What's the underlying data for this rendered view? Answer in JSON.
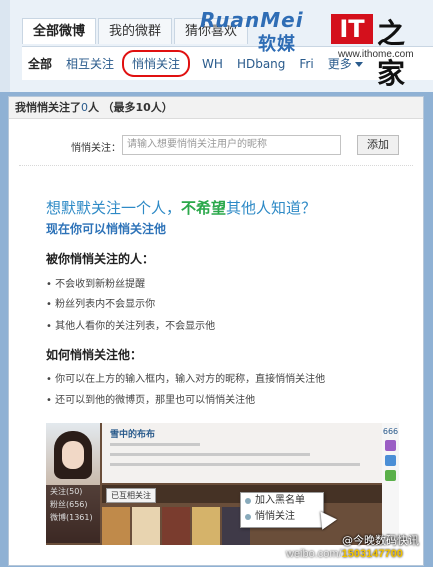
{
  "tabs_primary": [
    {
      "label": "全部微博",
      "active": true
    },
    {
      "label": "我的微群",
      "active": false
    },
    {
      "label": "猜你喜欢",
      "active": false
    }
  ],
  "tabs_secondary": [
    {
      "label": "全部",
      "active": true
    },
    {
      "label": "相互关注",
      "active": false
    },
    {
      "label": "悄悄关注",
      "active": false,
      "highlighted": true
    },
    {
      "label": "WH",
      "active": false
    },
    {
      "label": "HDbang",
      "active": false
    },
    {
      "label": "Fri",
      "active": false
    },
    {
      "label": "更多",
      "active": false
    }
  ],
  "logos": {
    "ruanmei_en": "RuanMei",
    "ruanmei_cn": "软媒",
    "ithome_it": "IT",
    "ithome_zh": "之家",
    "ithome_url": "www.ithome.com"
  },
  "panel": {
    "title_prefix": "我悄悄关注了",
    "count": "0",
    "title_suffix": "人",
    "limit": "（最多10人）",
    "add_label": "悄悄关注：",
    "add_placeholder": "请输入想要悄悄关注用户的昵称",
    "add_button": "添加"
  },
  "intro": {
    "headline_a": "想默默关注一个人，",
    "headline_b": "不希望",
    "headline_c": "其他人知道？",
    "subhead": "现在你可以悄悄关注他"
  },
  "sections": [
    {
      "title": "被你悄悄关注的人：",
      "items": [
        "• 不会收到新粉丝提醒",
        "• 粉丝列表内不会显示你",
        "• 其他人看你的关注列表，不会显示他"
      ]
    },
    {
      "title": "如何悄悄关注他：",
      "items": [
        "• 你可以在上方的输入框内，输入对方的昵称，直接悄悄关注他",
        "• 还可以到他的微博页，那里也可以悄悄关注他"
      ]
    }
  ],
  "illustration": {
    "name": "雪中的布布",
    "side_items": [
      "关注(50)",
      "粉丝(656)",
      "微博(1361)"
    ],
    "count": "666",
    "popup_items": [
      "加入黑名单",
      "悄悄关注"
    ],
    "button": "已互相关注"
  },
  "watermark": {
    "line1": "@今晚数码快讯",
    "line2_a": "weibo.com/",
    "line2_b": "1503147700"
  }
}
